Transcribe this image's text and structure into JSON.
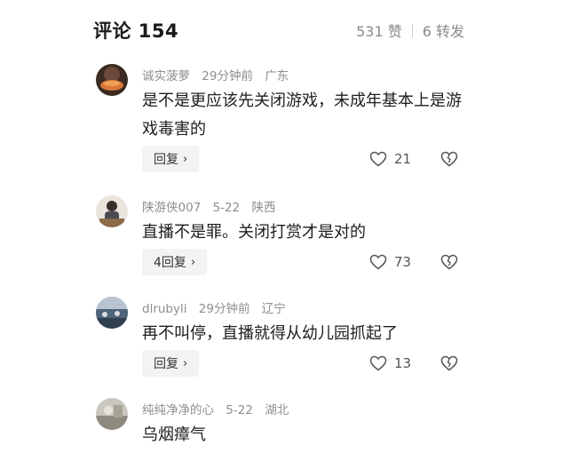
{
  "header": {
    "title": "评论 154",
    "likes": "531 赞",
    "shares": "6 转发"
  },
  "comments": [
    {
      "username": "诚实菠萝",
      "time": "29分钟前",
      "location": "广东",
      "text": "是不是更应该先关闭游戏，未成年基本上是游戏毒害的",
      "reply_label": "回复",
      "like_count": "21"
    },
    {
      "username": "陕游侠007",
      "time": "5-22",
      "location": "陕西",
      "text": "直播不是罪。关闭打赏才是对的",
      "reply_label": "4回复",
      "like_count": "73"
    },
    {
      "username": "dlrubyli",
      "time": "29分钟前",
      "location": "辽宁",
      "text": "再不叫停，直播就得从幼儿园抓起了",
      "reply_label": "回复",
      "like_count": "13"
    },
    {
      "username": "纯纯净净的心",
      "time": "5-22",
      "location": "湖北",
      "text": "乌烟瘴气"
    }
  ],
  "icons": {
    "like": "heart-outline-icon",
    "dislike": "thumbs-down-icon",
    "reply_chevron": "chevron-right-icon"
  },
  "colors": {
    "meta_gray": "#8e8e8e",
    "reply_bg": "#f3f3f3",
    "text": "#1e1e1e"
  }
}
